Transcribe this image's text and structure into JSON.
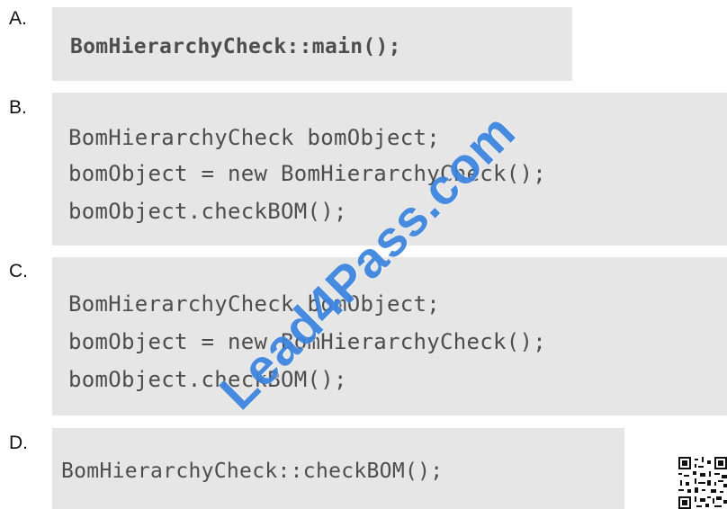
{
  "options": [
    {
      "letter": "A.",
      "lines": [
        "BomHierarchyCheck::main();"
      ]
    },
    {
      "letter": "B.",
      "lines": [
        "BomHierarchyCheck bomObject;",
        "bomObject = new BomHierarchyCheck();",
        "bomObject.checkBOM();"
      ]
    },
    {
      "letter": "C.",
      "lines": [
        "BomHierarchyCheck bomObject;",
        "bomObject = new BomHierarchyCheck();",
        "bomObject.checkBOM();"
      ]
    },
    {
      "letter": "D.",
      "lines": [
        "BomHierarchyCheck::checkBOM();"
      ]
    }
  ],
  "watermark": "Lead4Pass.com",
  "colors": {
    "code_text": "#4d4d4d",
    "code_background": "#e6e6e6",
    "watermark": "#2878dc"
  },
  "icons": {
    "qr_code": "qr-code-icon"
  }
}
